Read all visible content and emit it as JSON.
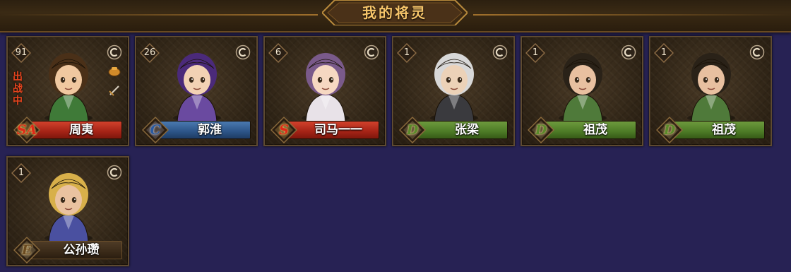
{
  "header": {
    "title": "我的将灵"
  },
  "cards": [
    {
      "level": "91",
      "name": "周夷",
      "grade": "SA",
      "theme": "red",
      "deployed_label": "出战中",
      "face": "#f0c8a0",
      "hair": "#4a3018",
      "robe": "#3f7a38"
    },
    {
      "level": "26",
      "name": "郭淮",
      "grade": "C",
      "theme": "blue",
      "deployed_label": "",
      "face": "#f2d2b4",
      "hair": "#4b2a7a",
      "robe": "#6a4aa0"
    },
    {
      "level": "6",
      "name": "司马一一",
      "grade": "S",
      "theme": "red",
      "deployed_label": "",
      "face": "#f6d8c2",
      "hair": "#7a5a8a",
      "robe": "#e8e2e8"
    },
    {
      "level": "1",
      "name": "张梁",
      "grade": "D",
      "theme": "green",
      "deployed_label": "",
      "face": "#ecd2b8",
      "hair": "#d8d8d8",
      "robe": "#3a3a3e"
    },
    {
      "level": "1",
      "name": "祖茂",
      "grade": "D",
      "theme": "green",
      "deployed_label": "",
      "face": "#e8c0a0",
      "hair": "#2a2218",
      "robe": "#4f7a3a"
    },
    {
      "level": "1",
      "name": "祖茂",
      "grade": "D",
      "theme": "green",
      "deployed_label": "",
      "face": "#e8c0a0",
      "hair": "#2a2218",
      "robe": "#4f7a3a"
    },
    {
      "level": "1",
      "name": "公孙瓒",
      "grade": "E",
      "theme": "brown",
      "deployed_label": "",
      "face": "#eac2a0",
      "hair": "#d8b04a",
      "robe": "#4a50a0"
    }
  ],
  "colors": {
    "background": "#272254",
    "title_gold": "#f6c56a",
    "deployed_red": "#e9451e"
  },
  "icons": [
    "coin-icon",
    "pouch-icon",
    "sword-icon"
  ]
}
